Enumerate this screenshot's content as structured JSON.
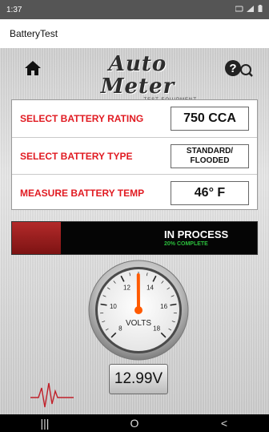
{
  "status_bar": {
    "time": "1:37",
    "icons": [
      "notification-icon",
      "signal-icon",
      "battery-icon"
    ]
  },
  "app_bar": {
    "title": "BatteryTest"
  },
  "header": {
    "brand_name": "Auto Meter",
    "brand_sub": "TEST EQUIPMENT",
    "icons": [
      "home-icon",
      "help-icon",
      "brand-logo-mark"
    ]
  },
  "settings": [
    {
      "label": "SELECT BATTERY RATING",
      "value": "750 CCA"
    },
    {
      "label": "SELECT BATTERY TYPE",
      "value_line1": "STANDARD/",
      "value_line2": "FLOODED"
    },
    {
      "label": "MEASURE BATTERY TEMP",
      "value": "46° F"
    }
  ],
  "progress": {
    "title": "IN PROCESS",
    "subtitle": "20% COMPLETE",
    "percent": 20,
    "fill_color": "#b32a2a",
    "subtitle_color": "#2bbf3c"
  },
  "gauge": {
    "label": "VOLTS",
    "ticks": [
      "8",
      "10",
      "12",
      "14",
      "16",
      "18"
    ],
    "min": 8,
    "max": 18,
    "value": 12.99,
    "needle_color": "#ff5a00"
  },
  "readout": {
    "value": "12.99V"
  },
  "nav_bar": {
    "recent": "|||",
    "home": "O",
    "back": "<"
  }
}
